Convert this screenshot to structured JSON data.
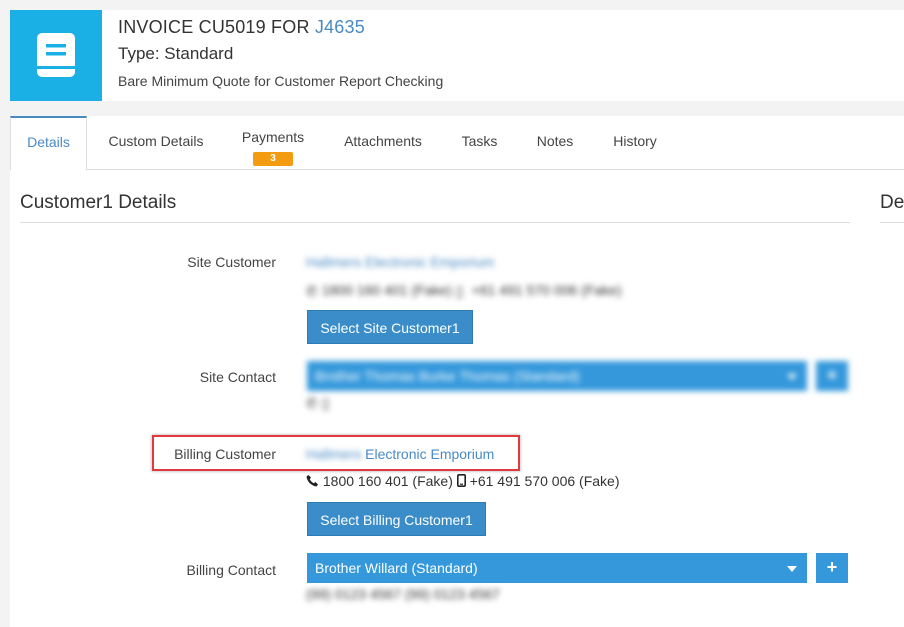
{
  "header": {
    "title_prefix": "INVOICE CU5019 FOR",
    "title_link": "J4635",
    "type": "Type: Standard",
    "description": "Bare Minimum Quote for Customer Report Checking",
    "icon": "book-icon",
    "icon_color": "#1ab0e6"
  },
  "tabs": [
    {
      "label": "Details",
      "active": true
    },
    {
      "label": "Custom Details"
    },
    {
      "label": "Payments",
      "badge": "3"
    },
    {
      "label": "Attachments"
    },
    {
      "label": "Tasks"
    },
    {
      "label": "Notes"
    },
    {
      "label": "History"
    }
  ],
  "section": {
    "title": "Customer1 Details",
    "title_right": "De"
  },
  "site_customer": {
    "label": "Site Customer",
    "name": "Hallmers Electronic Emporium",
    "phone": "1800 160 401 (Fake)",
    "mobile": "+61 491 570 006 (Fake)",
    "button": "Select Site Customer1"
  },
  "site_contact": {
    "label": "Site Contact",
    "value": "Brother Thomas Burke Thomas (Standard)",
    "plus": "+"
  },
  "billing_customer": {
    "label": "Billing Customer",
    "name_blurred": "Hallmers",
    "name": "Electronic Emporium",
    "phone": "1800 160 401 (Fake)",
    "mobile": "+61 491 570 006 (Fake)",
    "button": "Select Billing Customer1"
  },
  "billing_contact": {
    "label": "Billing Contact",
    "value": "Brother Willard (Standard)",
    "plus": "+",
    "info_blurred": "(99) 0123 4567 (99) 0123 4567"
  },
  "colors": {
    "accent": "#3498db",
    "badge": "#f39c12",
    "highlight": "#e0393e"
  }
}
